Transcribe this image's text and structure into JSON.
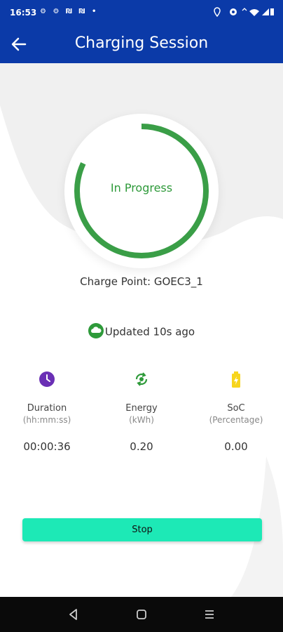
{
  "status_bar": {
    "time": "16:53",
    "left_icons": "⚙ ⚙ ₪ ₪ •",
    "right_icons": "◉ ◎ ▾ ▮"
  },
  "header": {
    "title": "Charging Session",
    "back_icon": "arrow-left"
  },
  "progress": {
    "status": "In Progress",
    "fraction": 0.82,
    "color": "#3a9e47"
  },
  "charge_point": "Charge Point: GOEC3_1",
  "updated": "Updated 10s ago",
  "metrics": [
    {
      "label": "Duration",
      "unit": "(hh:mm:ss)",
      "value": "00:00:36",
      "icon": "clock-icon",
      "icon_color": "#6a2fb5"
    },
    {
      "label": "Energy",
      "unit": "(kWh)",
      "value": "0.20",
      "icon": "energy-icon",
      "icon_color": "#2e9a3a"
    },
    {
      "label": "SoC",
      "unit": "(Percentage)",
      "value": "0.00",
      "icon": "battery-icon",
      "icon_color": "#f7d51d"
    }
  ],
  "stop_button": "Stop",
  "colors": {
    "brand": "#0b3aa8",
    "accent": "#1de9b6"
  }
}
